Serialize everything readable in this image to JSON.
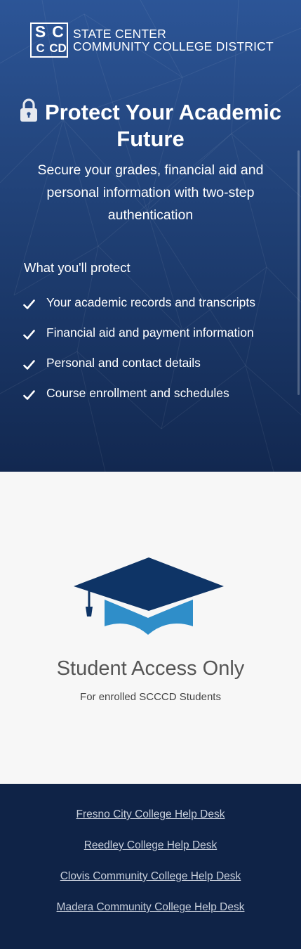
{
  "header": {
    "logo_letters": [
      "S",
      "C",
      "C",
      "C",
      "D"
    ],
    "org_line1": "STATE CENTER",
    "org_line2": "COMMUNITY COLLEGE DISTRICT"
  },
  "hero": {
    "title": "Protect Your Academic Future",
    "subtitle": "Secure your grades, financial aid and personal information with two-step authentication",
    "protect_heading": "What you'll protect",
    "protect_items": [
      "Your academic records and transcripts",
      "Financial aid and payment information",
      "Personal and contact details",
      "Course enrollment and schedules"
    ]
  },
  "access": {
    "title": "Student Access Only",
    "subtitle": "For enrolled SCCCD Students"
  },
  "footer": {
    "links": [
      "Fresno City College Help Desk",
      "Reedley College Help Desk",
      "Clovis Community College Help Desk",
      "Madera Community College Help Desk"
    ]
  },
  "colors": {
    "hero_top": "#2c5597",
    "hero_bottom": "#122850",
    "cap_dark": "#0e3466",
    "cap_light": "#2f8ec9",
    "footer_bg": "#0f2347"
  },
  "icons": [
    "lock-icon",
    "check-icon",
    "graduation-cap-icon"
  ]
}
